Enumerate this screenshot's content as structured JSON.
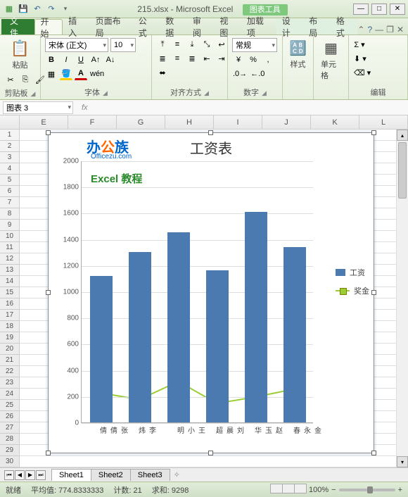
{
  "title": "215.xlsx - Microsoft Excel",
  "context_tool": "图表工具",
  "tabs": {
    "file": "文件",
    "list": [
      "开始",
      "插入",
      "页面布局",
      "公式",
      "数据",
      "审阅",
      "视图",
      "加载项"
    ],
    "ctx": [
      "设计",
      "布局",
      "格式"
    ]
  },
  "ribbon": {
    "clipboard": {
      "paste": "粘贴",
      "label": "剪贴板"
    },
    "font": {
      "name": "宋体 (正文)",
      "size": "10",
      "label": "字体"
    },
    "align": {
      "label": "对齐方式",
      "general": "常规"
    },
    "number": {
      "label": "数字"
    },
    "styles": {
      "btn": "样式",
      "label": ""
    },
    "cells": {
      "btn": "单元格",
      "label": ""
    },
    "editing": {
      "label": "编辑"
    }
  },
  "namebox": "图表 3",
  "fx": "fx",
  "columns": [
    "E",
    "F",
    "G",
    "H",
    "I",
    "J",
    "K",
    "L"
  ],
  "chart_data": {
    "type": "bar+line",
    "title": "工资表",
    "categories": [
      "张倩倩",
      "李炜",
      "王小明",
      "刘晨超",
      "赵玉华",
      "金永春"
    ],
    "series": [
      {
        "name": "工资",
        "type": "bar",
        "values": [
          1120,
          1300,
          1450,
          1160,
          1610,
          1340
        ]
      },
      {
        "name": "奖金",
        "type": "line",
        "values": [
          230,
          180,
          318,
          150,
          200,
          260
        ]
      }
    ],
    "ylim": [
      0,
      2000
    ],
    "ystep": 200
  },
  "watermark": {
    "brand_cn": "办公族",
    "brand_en": "Officezu.com",
    "tutorial": "Excel 教程"
  },
  "sheets": [
    "Sheet1",
    "Sheet2",
    "Sheet3"
  ],
  "status": {
    "mode": "就绪",
    "avg_label": "平均值:",
    "avg": "774.8333333",
    "count_label": "计数:",
    "count": "21",
    "sum_label": "求和:",
    "sum": "9298",
    "zoom": "100%"
  }
}
